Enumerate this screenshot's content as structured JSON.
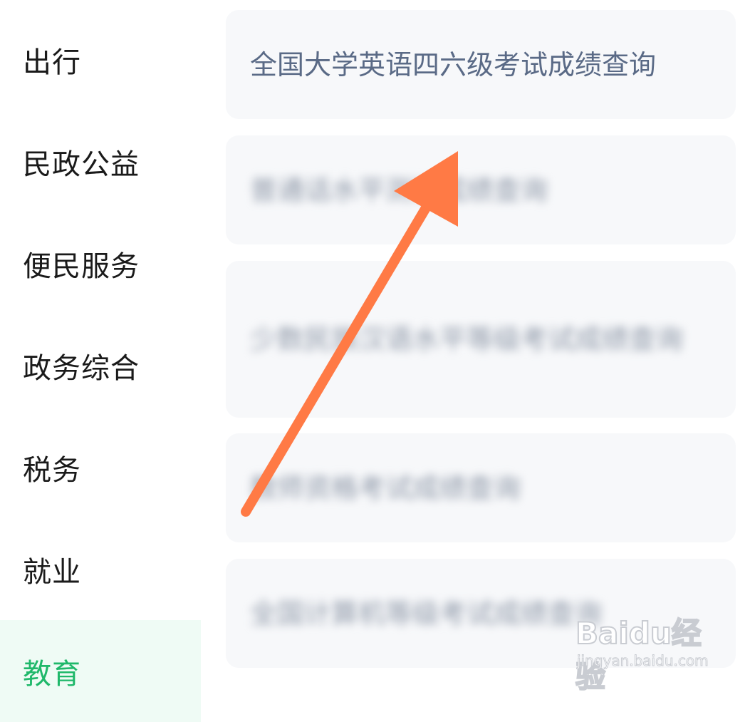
{
  "sidebar": {
    "items": [
      {
        "label": "出行"
      },
      {
        "label": "民政公益"
      },
      {
        "label": "便民服务"
      },
      {
        "label": "政务综合"
      },
      {
        "label": "税务"
      },
      {
        "label": "就业"
      },
      {
        "label": "教育",
        "active": true
      }
    ]
  },
  "content": {
    "cards": [
      {
        "label": "全国大学英语四六级考试成绩查询"
      },
      {
        "label": "普通话水平测试成绩查询",
        "blurred": true
      },
      {
        "label": "少数民族汉语水平等级考试成绩查询",
        "blurred": true
      },
      {
        "label": "教师资格考试成绩查询",
        "blurred": true
      },
      {
        "label": "全国计算机等级考试成绩查询",
        "blurred": true
      }
    ]
  },
  "annotation": {
    "arrow_color": "#ff7a45",
    "arrow_icon": "arrow-up-right-icon"
  },
  "watermark": {
    "brand": "Baidu经验",
    "url": "jingyan.baidu.com"
  },
  "colors": {
    "accent": "#1fb86a",
    "active_bg": "#effbf5",
    "card_bg": "#f7f8fa",
    "card_text": "#5a6a86"
  }
}
